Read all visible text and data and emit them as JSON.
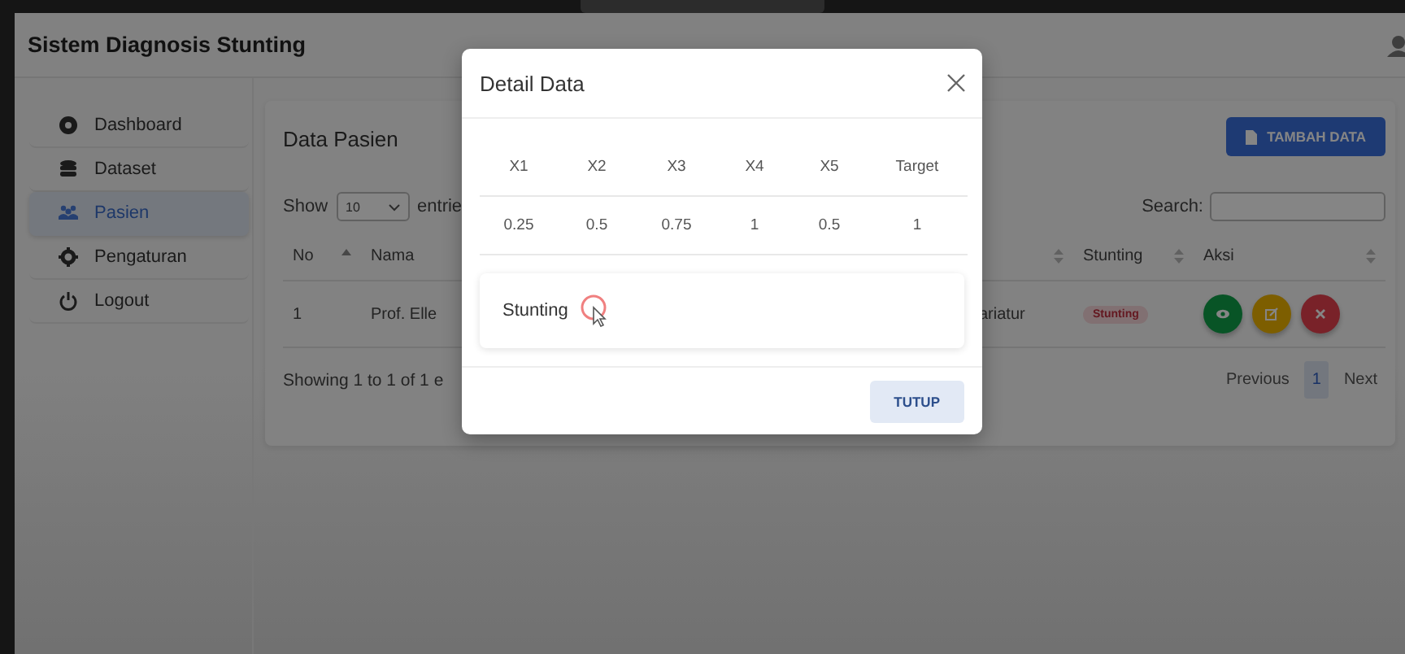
{
  "app": {
    "title": "Sistem Diagnosis Stunting"
  },
  "sidebar": {
    "items": [
      {
        "label": "Dashboard",
        "kind": "dashboard",
        "selected": false
      },
      {
        "label": "Dataset",
        "kind": "database",
        "selected": false
      },
      {
        "label": "Pasien",
        "kind": "users",
        "selected": true
      },
      {
        "label": "Pengaturan",
        "kind": "gear",
        "selected": false
      },
      {
        "label": "Logout",
        "kind": "power",
        "selected": false
      }
    ]
  },
  "page": {
    "title": "Data Pasien",
    "add_button": "TAMBAH DATA",
    "length_label": "Show",
    "length_value": "10",
    "length_suffix": "entrie",
    "search_label": "Search:"
  },
  "table": {
    "columns": [
      {
        "label": "No",
        "sorted": true
      },
      {
        "label": "Nama"
      },
      {
        "sorted": false
      },
      {
        "label": "Stunting",
        "sorted": false
      },
      {
        "label": "Aksi",
        "sorted": false
      }
    ],
    "rows": [
      {
        "no": "1",
        "nama": "Prof. Elle",
        "column_3": "ariatur",
        "stunting": "Stunting",
        "actions": [
          {
            "kind": "view"
          },
          {
            "kind": "edit"
          },
          {
            "kind": "delete"
          }
        ]
      }
    ],
    "info": "Showing 1 to 1 of 1 e",
    "pagination": [
      {
        "label": "Previous",
        "selected": false
      },
      {
        "label": "1",
        "selected": true
      },
      {
        "label": "Next",
        "selected": false
      }
    ]
  },
  "modal": {
    "title": "Detail Data",
    "columns": [
      "X1",
      "X2",
      "X3",
      "X4",
      "X5",
      "Target"
    ],
    "values": [
      "0.25",
      "0.5",
      "0.75",
      "1",
      "0.5",
      "1"
    ],
    "result": "Stunting",
    "button": "TUTUP"
  }
}
